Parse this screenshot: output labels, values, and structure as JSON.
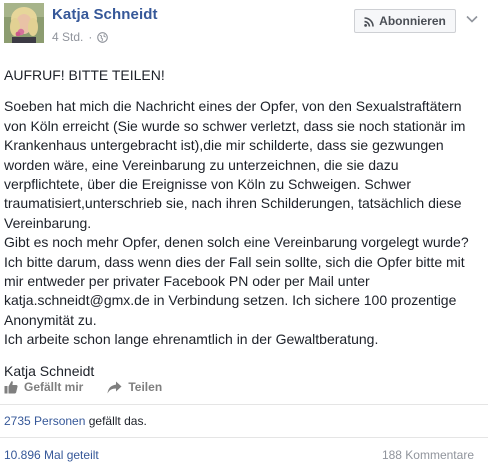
{
  "post": {
    "author": "Katja Schneidt",
    "timestamp": "4 Std.",
    "separator": "·",
    "follow_label": "Abonnieren",
    "paragraphs": [
      "AUFRUF! BITTE TEILEN!",
      "Soeben hat mich die Nachricht eines der Opfer, von den Sexualstraftätern von Köln erreicht (Sie wurde so schwer verletzt, dass sie noch stationär im Krankenhaus untergebracht ist),die mir schilderte, dass sie gezwungen worden wäre, eine Vereinbarung zu unterzeichnen, die sie dazu verpflichtete, über die Ereignisse von Köln zu Schweigen. Schwer traumatisiert,unterschrieb sie, nach ihren Schilderungen, tatsächlich diese Vereinbarung.",
      "Gibt es noch mehr Opfer, denen solch eine Vereinbarung vorgelegt wurde?",
      "Ich bitte darum, dass wenn dies der Fall sein sollte, sich die Opfer bitte mit mir entweder per privater Facebook PN oder per Mail unter katja.schneidt@gmx.de in Verbindung setzen. Ich sichere 100 prozentige Anonymität zu.",
      "Ich arbeite schon lange ehrenamtlich in der Gewaltberatung.",
      "Katja Schneidt"
    ]
  },
  "actions": {
    "like_label": "Gefällt mir",
    "share_label": "Teilen"
  },
  "stats": {
    "likes_count": "2735 Personen",
    "likes_suffix": " gefällt das.",
    "shares": "10.896 Mal geteilt",
    "comments": "188 Kommentare"
  },
  "icons": {
    "follow": "rss-icon",
    "menu": "chevron-down-icon",
    "audience": "globe-icon",
    "like": "thumbs-up-icon",
    "share": "share-arrow-icon"
  },
  "colors": {
    "link": "#365899",
    "meta": "#90949c",
    "text": "#1d2129",
    "action": "#7f7f7f"
  }
}
